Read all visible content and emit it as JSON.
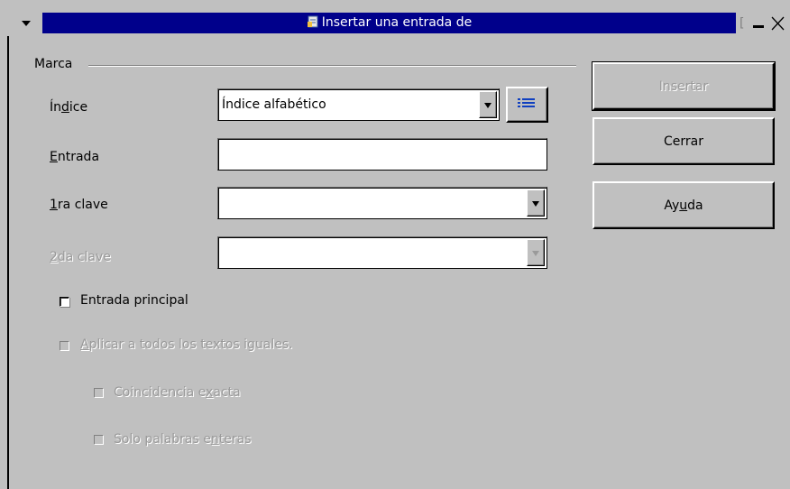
{
  "window": {
    "title": "Insertar una entrada de",
    "title_right_fragment": "["
  },
  "group": {
    "label": "Marca"
  },
  "fields": {
    "indice": {
      "label_pre": "Ín",
      "label_u": "d",
      "label_post": "ice",
      "value": "Índice alfabético"
    },
    "entrada": {
      "label_pre": "",
      "label_u": "E",
      "label_post": "ntrada",
      "value": ""
    },
    "clave1": {
      "label_pre": "",
      "label_u": "1",
      "label_post": "ra clave",
      "value": ""
    },
    "clave2": {
      "label_pre": "",
      "label_u": "2",
      "label_post": "da clave",
      "value": ""
    }
  },
  "checks": {
    "principal": {
      "label": "Entrada principal",
      "checked": false,
      "enabled": true
    },
    "aplicar": {
      "label_pre": "",
      "label_u": "A",
      "label_post": "plicar a todos los textos iguales.",
      "checked": false,
      "enabled": false
    },
    "exacta": {
      "label_pre": "Coincidencia e",
      "label_u": "x",
      "label_post": "acta",
      "checked": false,
      "enabled": false
    },
    "enteras": {
      "label_pre": "Solo palabras e",
      "label_u": "n",
      "label_post": "teras",
      "checked": false,
      "enabled": false
    }
  },
  "buttons": {
    "insertar": "Insertar",
    "cerrar": "Cerrar",
    "ayuda_pre": "Ay",
    "ayuda_u": "u",
    "ayuda_post": "da"
  },
  "colors": {
    "titlebar": "#00008b",
    "face": "#c0c0c0",
    "disabled_text": "#9a9a9a"
  }
}
